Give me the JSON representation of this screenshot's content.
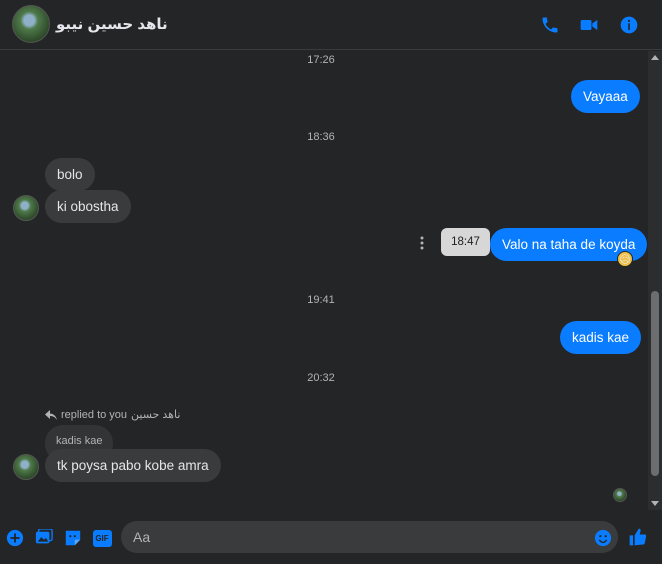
{
  "header": {
    "contact_name": "ناهد حسين نيبو",
    "icons": [
      "phone-icon",
      "video-camera-icon",
      "info-icon"
    ]
  },
  "timestamps": [
    "17:26",
    "18:36",
    "19:41",
    "20:32"
  ],
  "messages": [
    {
      "direction": "out",
      "text": "Vayaaa"
    },
    {
      "direction": "in",
      "text": "bolo"
    },
    {
      "direction": "in",
      "text": "ki obostha"
    },
    {
      "direction": "out",
      "text": "Valo na taha de koyda",
      "hover_time": "18:47",
      "reaction": "😥"
    },
    {
      "direction": "out",
      "text": "kadis kae"
    },
    {
      "direction": "in",
      "reply_label": "replied to you",
      "reply_name": "ناهد حسين",
      "quoted": "kadis kae",
      "text": "tk poysa pabo kobe amra"
    }
  ],
  "composer": {
    "placeholder": "Aa",
    "icons": [
      "plus-icon",
      "image-icon",
      "sticker-icon",
      "gif-icon",
      "emoji-icon",
      "like-icon"
    ],
    "gif_label": "GIF"
  },
  "colors": {
    "accent": "#0a7cff",
    "background": "#242526",
    "incoming_bubble": "#3a3b3c"
  }
}
